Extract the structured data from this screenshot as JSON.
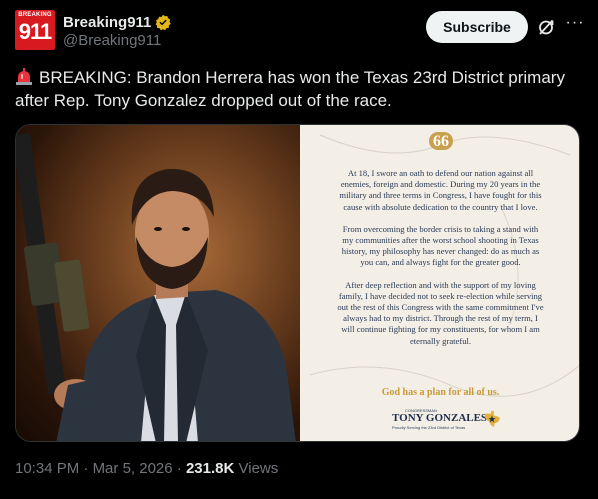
{
  "account": {
    "avatar_small": "BREAKING",
    "avatar_big": "911",
    "display_name": "Breaking911",
    "handle": "@Breaking911"
  },
  "actions": {
    "subscribe_label": "Subscribe"
  },
  "tweet": {
    "text": "BREAKING: Brandon Herrera has won the Texas 23rd District primary after Rep. Tony Gonzalez dropped out of the race."
  },
  "letter": {
    "quote_mark": "66",
    "lines": [
      [
        "At 18, I swore an oath to defend our nation against all",
        "enemies, foreign and domestic. During my 20 years in the",
        "military and three terms in Congress, I have fought for this",
        "cause with absolute dedication to the country that I love."
      ],
      [
        "From overcoming the border crisis to taking a stand with",
        "my communities after the worst school shooting in Texas",
        "history, my philosophy has never changed: do as much as",
        "you can, and always fight for the greater good."
      ],
      [
        "After deep reflection and with the support of my loving",
        "family, I have decided not to seek re-election while serving",
        "out the rest of this Congress with the same commitment I've",
        "always had to my district. Through the rest of my term, I",
        "will continue fighting for my constituents, for whom I am",
        "eternally grateful."
      ]
    ],
    "motto": "God has a plan for all of us.",
    "signature_label": "CONGRESSMAN",
    "signature_name": "TONY GONZALES",
    "signature_sub": "Proudly Serving the 23rd District of Texas"
  },
  "meta": {
    "time": "10:34 PM",
    "separator": "·",
    "date": "Mar 5, 2026",
    "views_count": "231.8K",
    "views_label": "Views"
  },
  "colors": {
    "background": "#000000",
    "text_primary": "#e7e9ea",
    "text_secondary": "#71767b",
    "verified_gold": "#e2b719",
    "avatar_red": "#d71920",
    "letter_gold": "#c89a3a"
  }
}
